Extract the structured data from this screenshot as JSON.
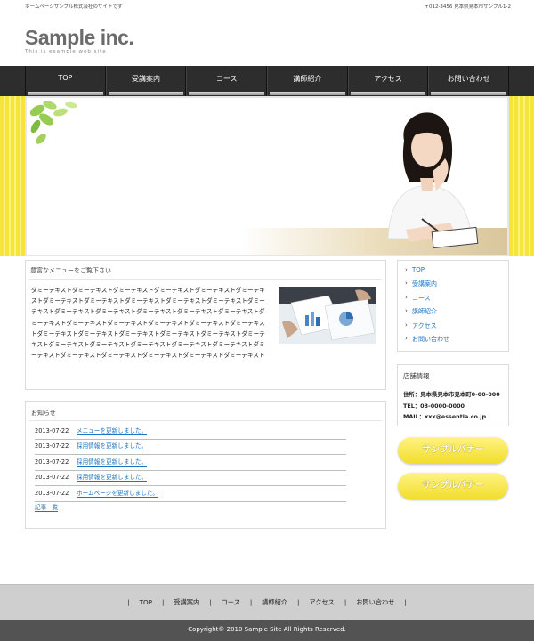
{
  "header": {
    "tagline": "ホームページサンプル株式会社のサイトです",
    "address": "〒012-3456 見本県見本市サンプル1-2",
    "logo_name": "Sample inc.",
    "logo_sub": "This is example web site"
  },
  "nav": {
    "items": [
      {
        "label": "TOP"
      },
      {
        "label": "受講案内"
      },
      {
        "label": "コース"
      },
      {
        "label": "講師紹介"
      },
      {
        "label": "アクセス"
      },
      {
        "label": "お問い合わせ"
      }
    ]
  },
  "main": {
    "heading": "豊富なメニューをご覧下さい",
    "body": "ダミーテキストダミーテキストダミーテキストダミーテキストダミーテキストダミーテキストダミーテキストダミーテキストダミーテキストダミーテキストダミーテキストダミーテキストダミーテキストダミーテキストダミーテキストダミーテキストダミーテキストダミーテキストダミーテキストダミーテキストダミーテキストダミーテキストダミーテキストダミーテキストダミーテキストダミーテキストダミーテキストダミーテキストダミーテキストダミーテキストダミーテキストダミーテキストダミーテキストダミーテキストダミーテキストダミーテキストダミーテキストダミーテキストダミーテキストダミーテキスト"
  },
  "news": {
    "heading": "お知らせ",
    "items": [
      {
        "date": "2013-07-22",
        "text": "メニューを更新しました。"
      },
      {
        "date": "2013-07-22",
        "text": "採用情報を更新しました。"
      },
      {
        "date": "2013-07-22",
        "text": "採用情報を更新しました。"
      },
      {
        "date": "2013-07-22",
        "text": "採用情報を更新しました。"
      },
      {
        "date": "2013-07-22",
        "text": "ホームページを更新しました。"
      }
    ],
    "more": "記事一覧"
  },
  "sidebar": {
    "arrow": "›",
    "items": [
      {
        "label": "TOP"
      },
      {
        "label": "受講案内"
      },
      {
        "label": "コース"
      },
      {
        "label": "講師紹介"
      },
      {
        "label": "アクセス"
      },
      {
        "label": "お問い合わせ"
      }
    ]
  },
  "shop": {
    "title": "店舗情報",
    "address": "住所：見本県見本市見本町0-00-000",
    "tel": "TEL：03-0000-0000",
    "mail": "MAIL：xxx@essentia.co.jp"
  },
  "banners": [
    "サンプルバナー",
    "サンプルバナー"
  ],
  "footer": {
    "separator": "|",
    "links": [
      "TOP",
      "受講案内",
      "コース",
      "講師紹介",
      "アクセス",
      "お問い合わせ"
    ],
    "copyright": "Copyright© 2010 Sample Site All Rights Reserved."
  },
  "colors": {
    "nav_bg": "#2d2d2d",
    "accent_yellow": "#f5e43a",
    "link_blue": "#1a73c4",
    "footer_bg": "#535353"
  }
}
